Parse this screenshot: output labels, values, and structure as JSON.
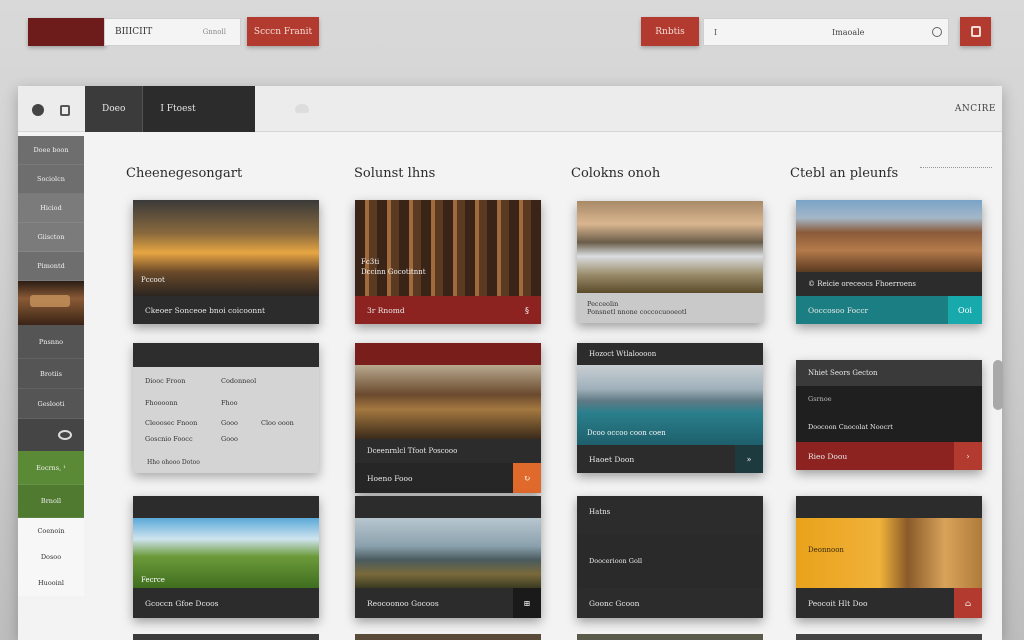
{
  "topbar": {
    "input_left_value": "BIIICIIT",
    "input_left_hint": "Gnnoll",
    "button_left_label": "Scccn Franit",
    "button_right_label": "Rnbtis",
    "search_left_text": "I",
    "search_value": "Imaoale"
  },
  "panel_header": {
    "tab_1": "Doeo",
    "tab_2": "I Ftoest",
    "right_label": "ANCIRE"
  },
  "sidebar": {
    "items": [
      "Doee boon",
      "Sociolcn",
      "Hiciod",
      "Giiscton",
      "Pimontd",
      "Pnsnno",
      "Brotiis",
      "Geslooti",
      "Eocrns, ¹",
      "Brnoll",
      "Coenoin",
      "Dosoo",
      "Huooinl"
    ]
  },
  "columns": [
    {
      "title": "Cheenegesongart"
    },
    {
      "title": "Solunst lhns"
    },
    {
      "title": "Colokns onoh"
    },
    {
      "title": "Ctebl an pleunfs"
    }
  ],
  "cards": {
    "c1r1": {
      "bar": "Ckeoer Sonceoe bnoi coicoonnt",
      "cap": "Pccoot"
    },
    "c2r1": {
      "bar": "3r Rnomd",
      "cap1": "Fc3ti",
      "cap2": "Dccinn Gocotitnnt",
      "chip": "§"
    },
    "c3r1": {
      "bar1": "Pecceolin",
      "bar2": "Ponsnetl nnone coccocuooeotl"
    },
    "c4r1": {
      "bar": "Ooccosoo Foccr",
      "cap": "© Reicie oreceocs Fhoerroens",
      "chip": "Ooi"
    },
    "c1r2": {
      "rows": [
        [
          "Diooc Froon",
          "Codonneol"
        ],
        [
          "Fhoooonn",
          "Fhoo"
        ],
        [
          "Cleoosec Fnoon",
          "Gooo",
          "Cloo ooon"
        ],
        [
          "Goscnio Foocc",
          "Gooo"
        ]
      ],
      "footer": "Hho ohooo Dotoo"
    },
    "c2r2": {
      "cap": "Dceenrnlcl Tfoot Poscooo",
      "bar": "Hoeno Fooo",
      "chip": "↻"
    },
    "c3r2": {
      "header": "Hozoct Wtlaloooon",
      "cap": "Dcoo occoo coon coen",
      "bar": "Haoet Doon",
      "chip": "»"
    },
    "c4r2": {
      "row1": "Nhiet Seors Gecton",
      "row2": "Gsrnoe",
      "row3": "Doocoon Cnocolat Noocrt",
      "bar": "Rieo Doou",
      "chip": "›"
    },
    "c1r3": {
      "cap": "Fecrce",
      "bar": "Gcoccn Gfoe Dcoos"
    },
    "c2r3": {
      "bar": "Reocoonoo Gocoos",
      "chip": "⊞"
    },
    "c3r3": {
      "header": "Hatns",
      "cap": "Doocerioon Goll",
      "bar": "Goonc Gcoon"
    },
    "c4r3": {
      "cap": "Deonnoon",
      "bar": "Peocoit Hlt Doo",
      "chip": "⌂"
    }
  },
  "colors": {
    "accent_red": "#b23a2e",
    "dark_red": "#8c2320",
    "teal": "#1b7e82",
    "green": "#5a8a36",
    "orange": "#e06a2c"
  }
}
